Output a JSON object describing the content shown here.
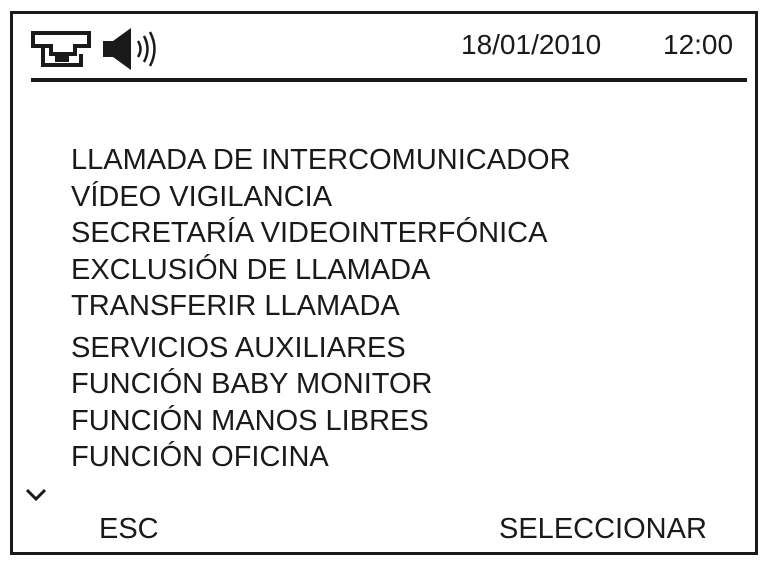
{
  "status": {
    "intercom_icon": "intercom-icon",
    "speaker_icon": "speaker-volume-icon",
    "date": "18/01/2010",
    "time": "12:00"
  },
  "menu": {
    "items": [
      "LLAMADA DE INTERCOMUNICADOR",
      "VÍDEO VIGILANCIA",
      "SECRETARÍA VIDEOINTERFÓNICA",
      "EXCLUSIÓN DE LLAMADA",
      "TRANSFERIR LLAMADA",
      "SERVICIOS AUXILIARES",
      "FUNCIÓN BABY MONITOR",
      "FUNCIÓN MANOS LIBRES",
      "FUNCIÓN OFICINA"
    ],
    "scroll_icon": "chevron-down-icon"
  },
  "softkeys": {
    "left": "ESC",
    "right": "SELECCIONAR"
  }
}
